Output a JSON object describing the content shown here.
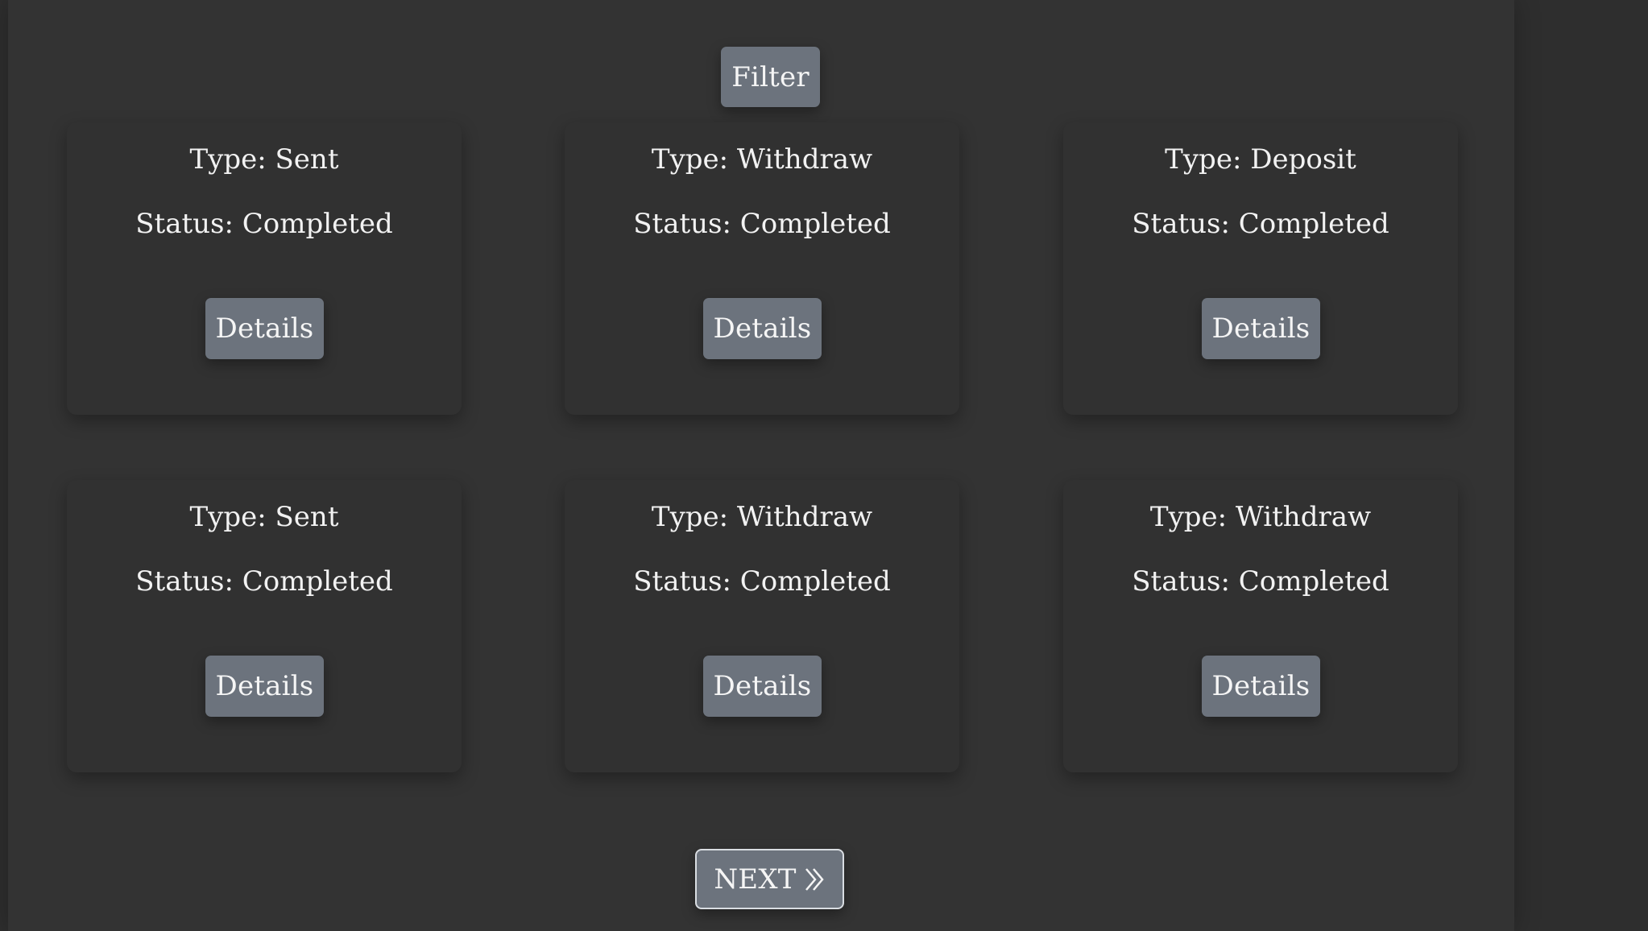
{
  "toolbar": {
    "filter_label": "Filter"
  },
  "transactions": [
    {
      "type_label": "Type: Sent",
      "status_label": "Status: Completed",
      "details_label": "Details"
    },
    {
      "type_label": "Type: Withdraw",
      "status_label": "Status: Completed",
      "details_label": "Details"
    },
    {
      "type_label": "Type: Deposit",
      "status_label": "Status: Completed",
      "details_label": "Details"
    },
    {
      "type_label": "Type: Sent",
      "status_label": "Status: Completed",
      "details_label": "Details"
    },
    {
      "type_label": "Type: Withdraw",
      "status_label": "Status: Completed",
      "details_label": "Details"
    },
    {
      "type_label": "Type: Withdraw",
      "status_label": "Status: Completed",
      "details_label": "Details"
    }
  ],
  "pagination": {
    "next_label": "NEXT",
    "next_icon": "double-chevron-right-icon"
  },
  "colors": {
    "background": "#333333",
    "card": "#313131",
    "button": "#6c737d",
    "text": "#f2f2f2"
  }
}
